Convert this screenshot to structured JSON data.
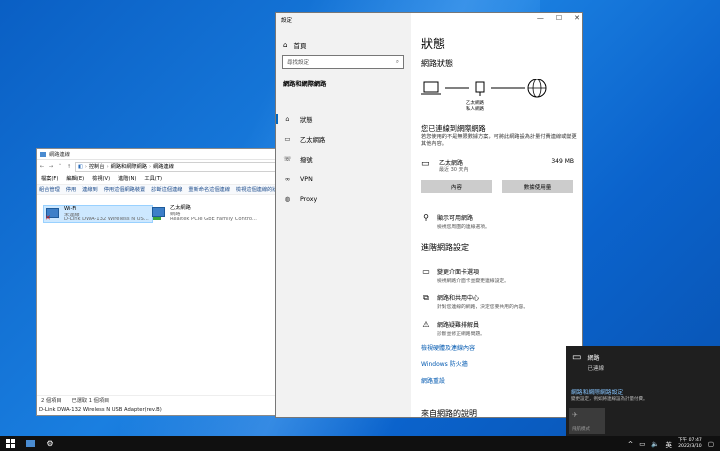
{
  "explorer": {
    "title": "網路連線",
    "breadcrumbs": [
      "控制台",
      "網路和網際網路",
      "網路連線"
    ],
    "menu": [
      "檔案(F)",
      "編輯(E)",
      "檢視(V)",
      "進階(N)",
      "工具(T)"
    ],
    "commands": [
      "組合管理",
      "停用",
      "連線到",
      "停用這個網路裝置",
      "診斷這個連線",
      "重新命名這個連線",
      "檢視這個連線的狀態"
    ],
    "items": [
      {
        "name": "Wi-Fi",
        "status": "未連線",
        "device": "D-Link DWA-132 Wireless N US..."
      },
      {
        "name": "乙太網路",
        "status": "網路",
        "device": "Realtek PCIe GbE Family Contro..."
      }
    ],
    "status": {
      "count": "2 個項目",
      "selected": "已選取 1 個項目"
    },
    "bottom_text": "D-Link DWA-132 Wireless N USB Adapter(rev.B)"
  },
  "settings": {
    "title": "設定",
    "home": "首頁",
    "search_placeholder": "尋找設定",
    "section": "網路和網際網路",
    "nav": [
      {
        "label": "狀態",
        "icon": "home"
      },
      {
        "label": "乙太網路",
        "icon": "monitor"
      },
      {
        "label": "撥號",
        "icon": "phone"
      },
      {
        "label": "VPN",
        "icon": "vpn"
      },
      {
        "label": "Proxy",
        "icon": "globe"
      }
    ],
    "page_title": "狀態",
    "network_status_heading": "網路狀態",
    "diagram_label1": "乙太網路",
    "diagram_label2": "私人網路",
    "connected_heading": "您已連線到網際網路",
    "connected_desc": "若您使用的不是無限數據方案，可將此網路設為計量付費連線或變更其他內容。",
    "connection": {
      "name": "乙太網路",
      "sub": "最近 30 天內",
      "usage": "349 MB"
    },
    "buttons": {
      "properties": "內容",
      "data_usage": "數據使用量"
    },
    "show_available": "顯示可用網路",
    "show_available_desc": "檢視您周圍的連線選項。",
    "advanced_heading": "進階網路設定",
    "advanced": [
      {
        "title": "變更介面卡選項",
        "desc": "檢視網路介面卡並變更連線設定。"
      },
      {
        "title": "網路和共用中心",
        "desc": "針對您連線的網路，決定您要共用的內容。"
      },
      {
        "title": "網路疑難排解員",
        "desc": "診斷並修正網路問題。"
      }
    ],
    "links": [
      "檢視硬體及連線內容",
      "Windows 防火牆",
      "網路重設"
    ],
    "web_help_heading": "來自網路的說明"
  },
  "flyout": {
    "network_name": "網路",
    "network_status": "已連線",
    "settings_link": "網路和網際網路設定",
    "settings_desc": "變更設定，例如將連線設為計量付費。",
    "tile_label": "飛航模式"
  },
  "taskbar": {
    "time": "下午 07:47",
    "date": "2022/3/10",
    "ime": "英"
  }
}
